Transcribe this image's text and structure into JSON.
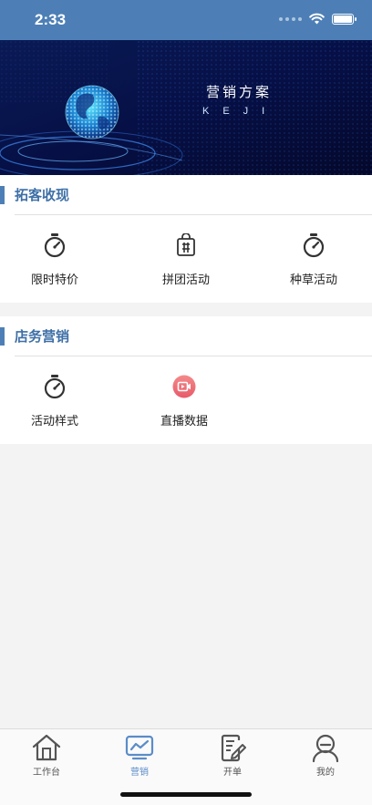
{
  "status_bar": {
    "time": "2:33"
  },
  "banner": {
    "title": "营销方案",
    "subtitle": "KEJI"
  },
  "sections": [
    {
      "title": "拓客收现",
      "items": [
        {
          "label": "限时特价",
          "icon": "stopwatch-icon"
        },
        {
          "label": "拼团活动",
          "icon": "group-bag-icon"
        },
        {
          "label": "种草活动",
          "icon": "stopwatch-icon"
        }
      ]
    },
    {
      "title": "店务营销",
      "items": [
        {
          "label": "活动样式",
          "icon": "stopwatch-icon"
        },
        {
          "label": "直播数据",
          "icon": "live-video-icon"
        }
      ]
    }
  ],
  "tabbar": {
    "items": [
      {
        "label": "工作台",
        "icon": "workbench-icon"
      },
      {
        "label": "营销",
        "icon": "marketing-chart-icon",
        "active": true
      },
      {
        "label": "开单",
        "icon": "order-edit-icon"
      },
      {
        "label": "我的",
        "icon": "profile-icon"
      }
    ]
  },
  "colors": {
    "primary": "#4d7fb6",
    "active_tab": "#5b8cc8",
    "live_icon": "#ee6f6f"
  }
}
